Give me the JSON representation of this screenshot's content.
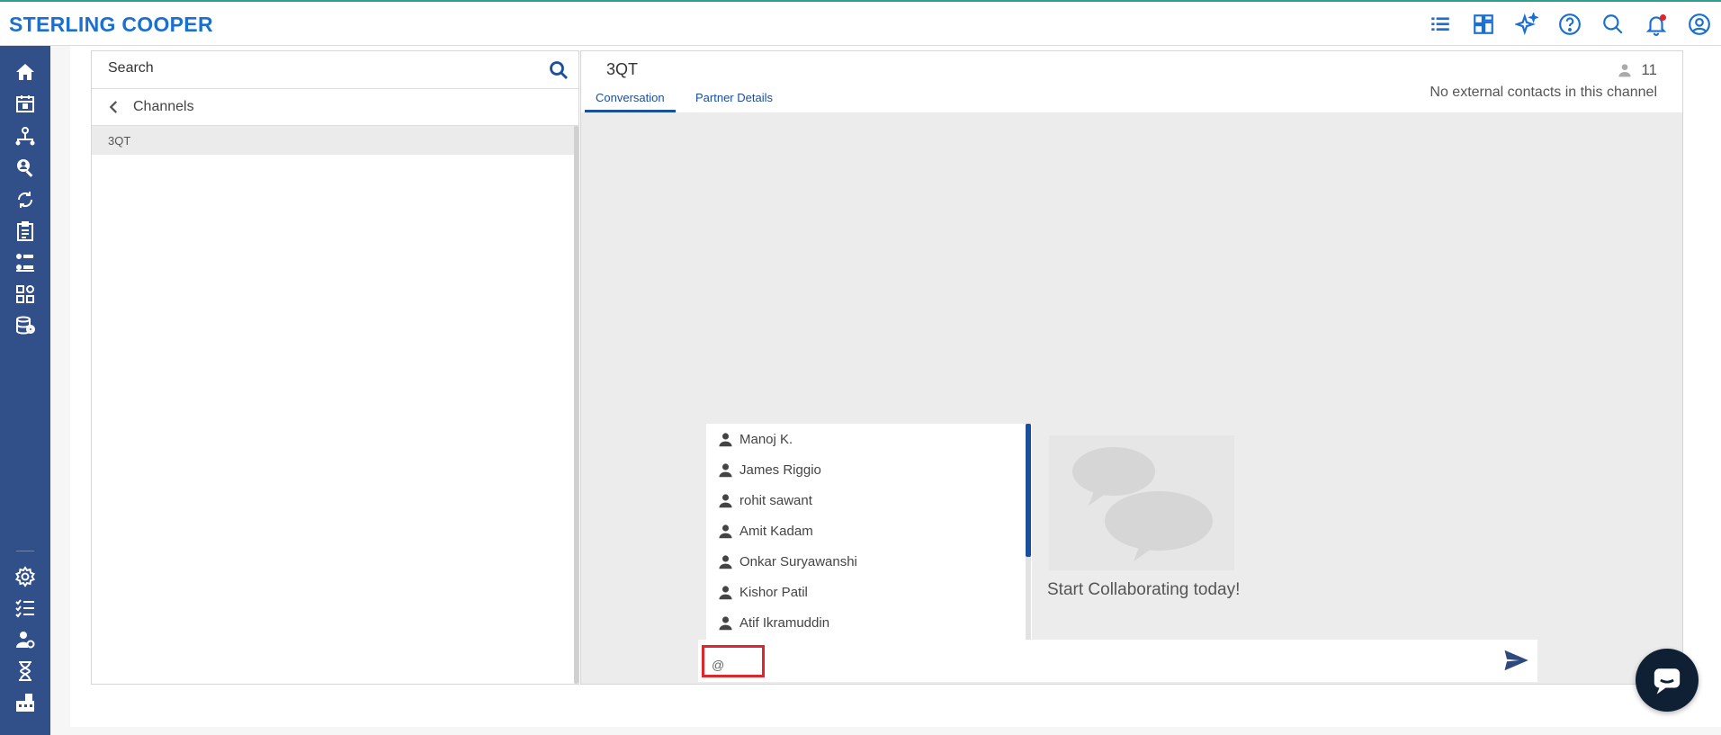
{
  "brand": {
    "name": "STERLING COOPER"
  },
  "topbar": {
    "icons": [
      "list-icon",
      "dashboard-grid-icon",
      "sparkle-ai-icon",
      "help-icon",
      "search-icon",
      "notification-bell-icon",
      "user-profile-icon"
    ],
    "notification_dot_color": "#e0252c"
  },
  "rail": {
    "icons": [
      "home-icon",
      "calendar-icon",
      "org-chart-icon",
      "search-profile-icon",
      "sync-icon",
      "clipboard-icon",
      "hierarchy-icon",
      "apps-icon",
      "database-icon",
      "settings-icon",
      "checklist-icon",
      "user-settings-icon",
      "hourglass-icon",
      "building-icon"
    ],
    "background": "#31508a"
  },
  "channels": {
    "search_label": "Search",
    "header": "Channels",
    "items": [
      "3QT"
    ]
  },
  "conversation": {
    "title": "3QT",
    "tabs": [
      "Conversation",
      "Partner Details"
    ],
    "active_tab": "Conversation",
    "member_count": "11",
    "external_note": "No external contacts in this channel"
  },
  "mentions": {
    "users": [
      "Manoj K.",
      "James Riggio",
      "rohit sawant",
      "Amit Kadam",
      "Onkar Suryawanshi",
      "Kishor Patil",
      "Atif Ikramuddin"
    ]
  },
  "empty_state": {
    "text": "Start Collaborating today!"
  },
  "composer": {
    "value": "@"
  },
  "colors": {
    "accent": "#1a4f9c",
    "brand": "#1a6fd0",
    "highlight": "#e0252c"
  }
}
